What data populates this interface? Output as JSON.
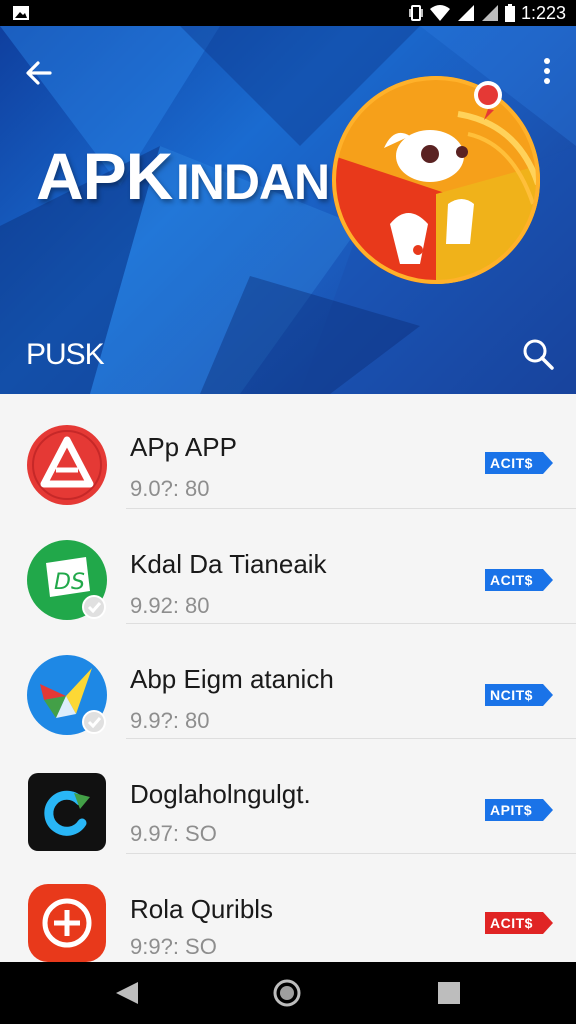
{
  "status_bar": {
    "time": "1:223"
  },
  "header": {
    "title_big": "APK",
    "title_small": "INDAN",
    "section_label": "PUSK"
  },
  "apps": [
    {
      "name": "APp APP",
      "meta": "9.0?: 80",
      "action": "ACIT$",
      "icon": "red-triangle-icon",
      "action_color": "#1a73e8"
    },
    {
      "name": "Kdal Da Tianeaik",
      "meta": "9.92: 80",
      "action": "ACIT$",
      "icon": "green-ds-icon",
      "action_color": "#1a73e8"
    },
    {
      "name": "Abp Eigm atanich",
      "meta": "9.9?: 80",
      "action": "NCIT$",
      "icon": "blue-compass-icon",
      "action_color": "#1a73e8"
    },
    {
      "name": "Doglaholngulgt.",
      "meta": "9.97: SO",
      "action": "APIT$",
      "icon": "dark-refresh-icon",
      "action_color": "#1a73e8"
    },
    {
      "name": "Rola Quribls",
      "meta": "9:9?: SO",
      "action": "ACIT$",
      "icon": "red-plus-icon",
      "action_color": "#e02424"
    }
  ]
}
